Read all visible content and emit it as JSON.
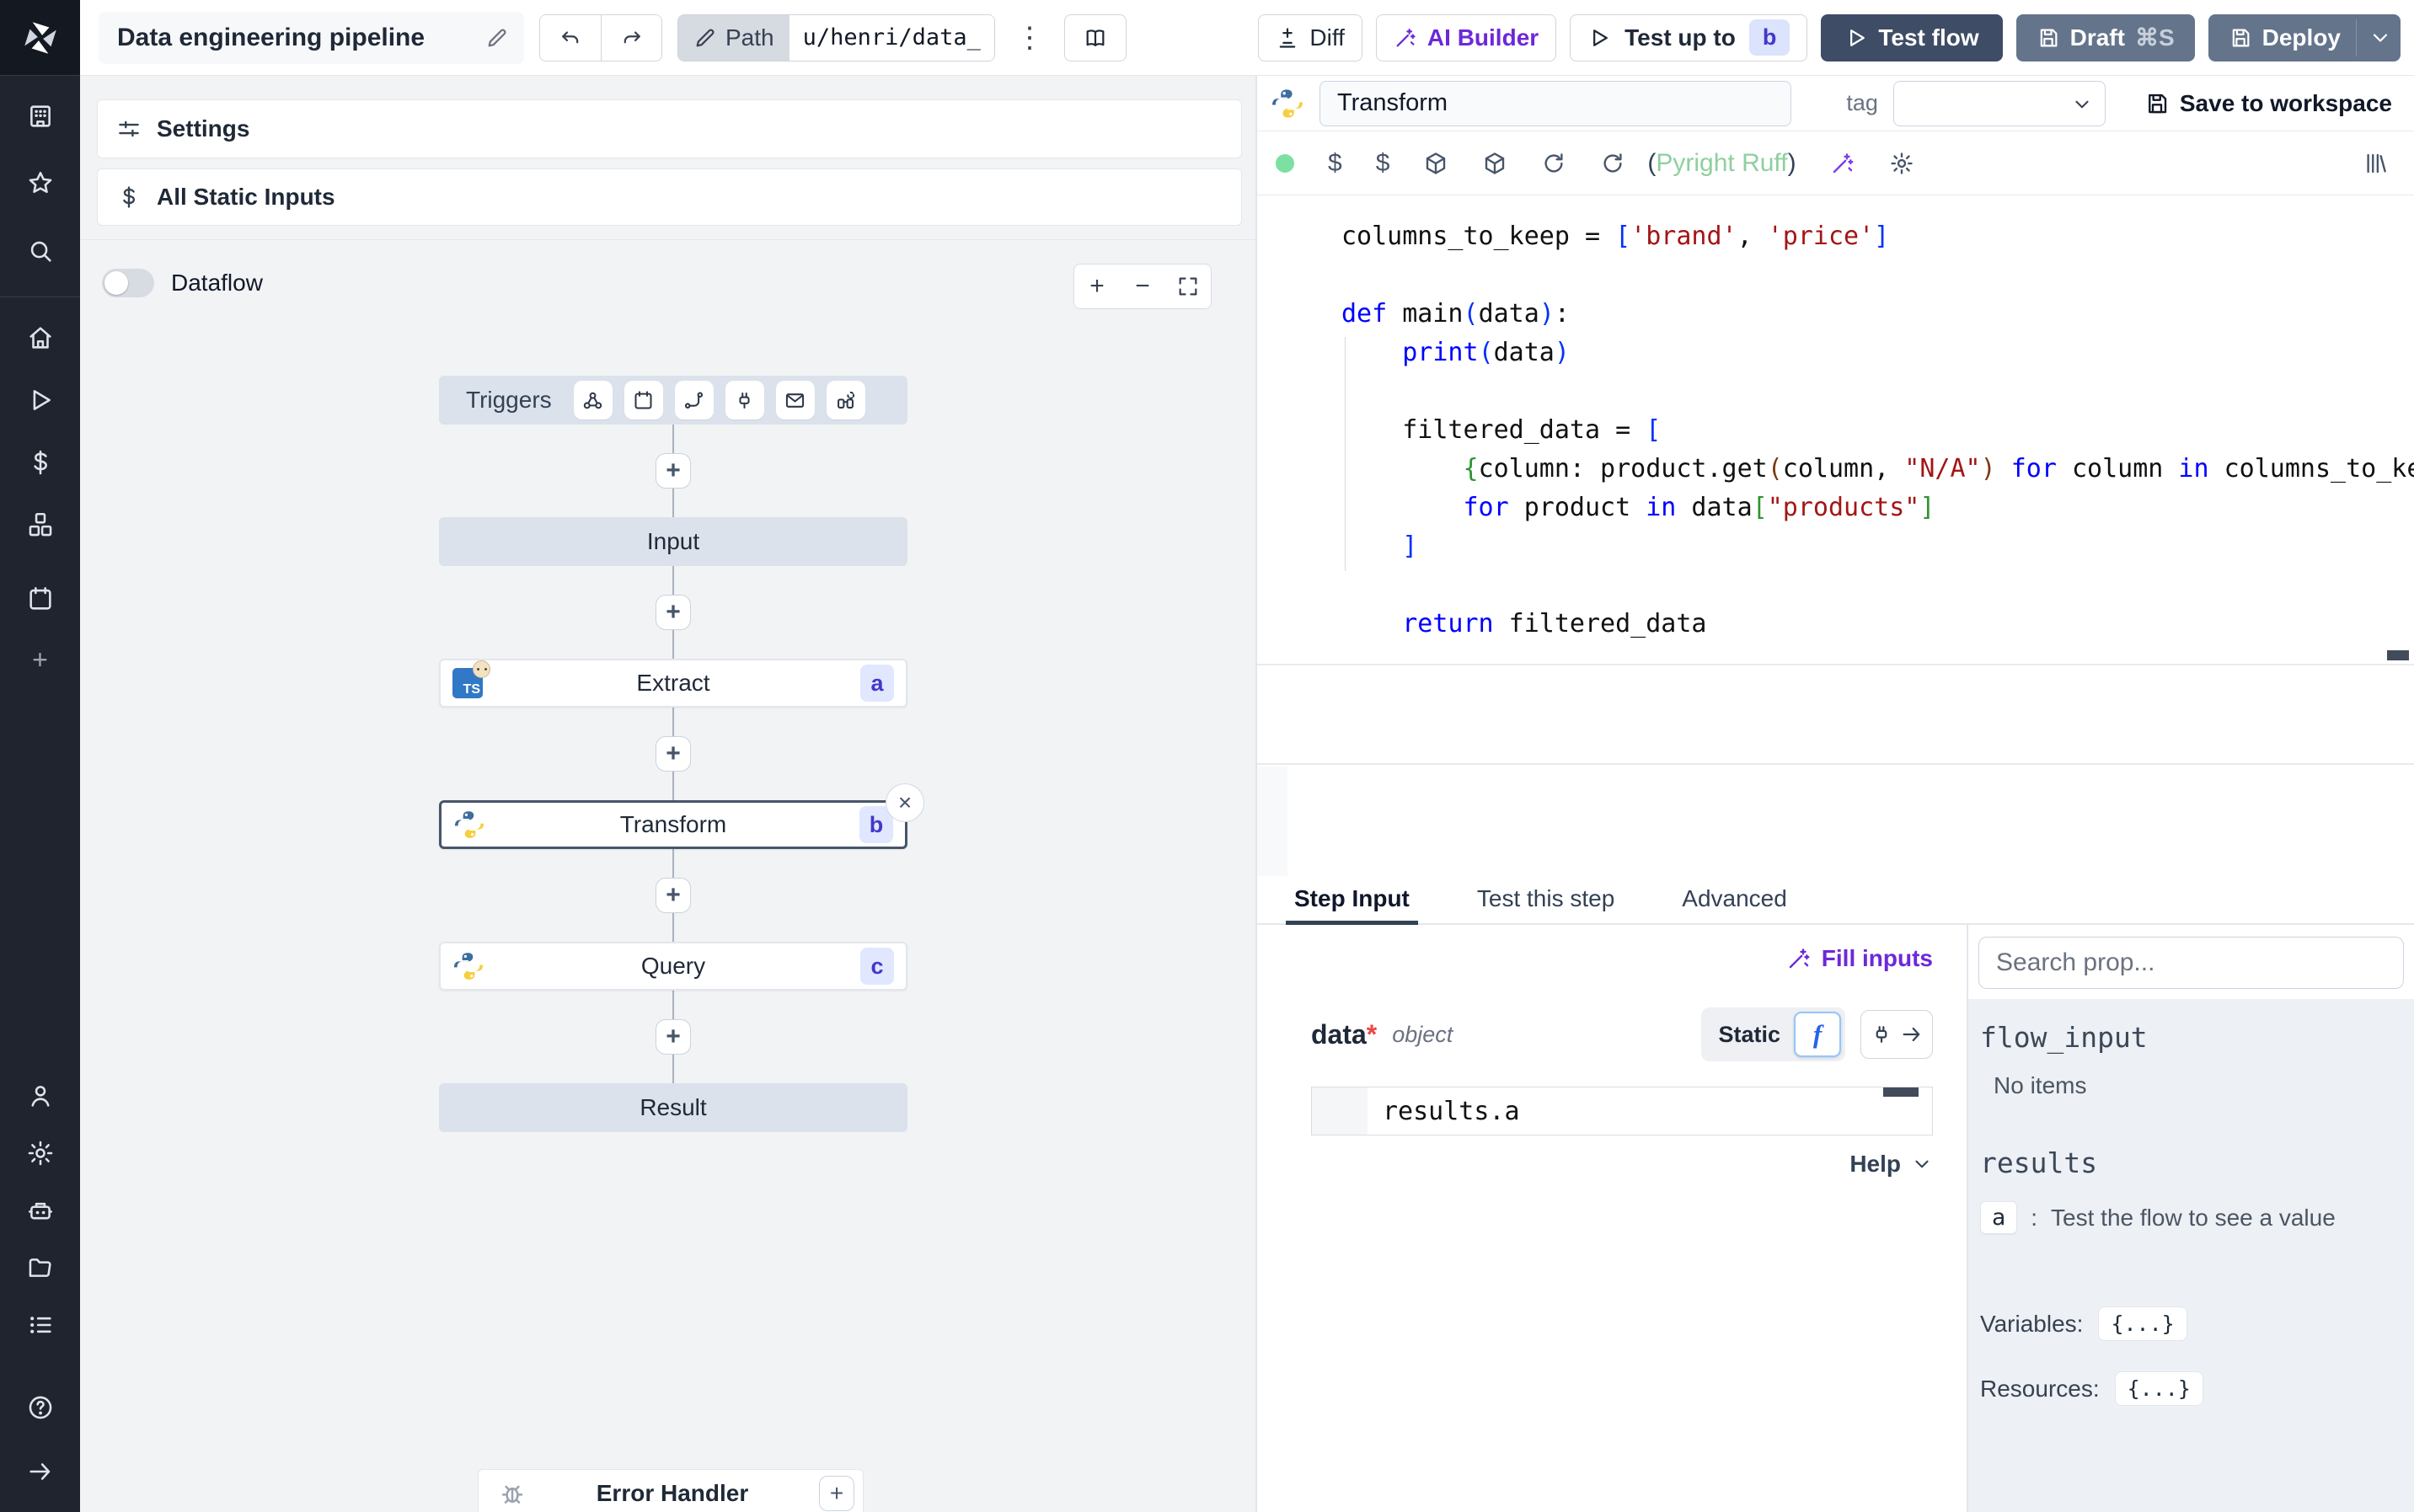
{
  "topbar": {
    "title": "Data engineering pipeline",
    "path_label": "Path",
    "path_value": "u/henri/data_",
    "diff_label": "Diff",
    "ai_builder_label": "AI Builder",
    "test_up_to_label": "Test up to",
    "test_up_to_badge": "b",
    "test_flow_label": "Test flow",
    "draft_label": "Draft",
    "draft_shortcut": "⌘S",
    "deploy_label": "Deploy"
  },
  "sidebar": {
    "icons_top": [
      "apps-icon",
      "favorites-icon",
      "search-icon"
    ],
    "icons_main": [
      "home-icon",
      "runs-icon",
      "variables-icon",
      "resources-icon",
      "schedules-icon",
      "add-icon"
    ],
    "icons_bottom": [
      "user-icon",
      "settings-icon",
      "workers-icon",
      "folders-icon",
      "logs-icon",
      "help-icon",
      "collapse-icon"
    ]
  },
  "flow_panel": {
    "settings_label": "Settings",
    "all_static_inputs_label": "All Static Inputs",
    "dataflow_label": "Dataflow",
    "graph": {
      "triggers_label": "Triggers",
      "trigger_icons": [
        "webhook-icon",
        "schedule-icon",
        "route-icon",
        "websocket-icon",
        "email-icon",
        "poll-icon"
      ],
      "input_label": "Input",
      "result_label": "Result",
      "error_handler_label": "Error Handler",
      "nodes": [
        {
          "label": "Extract",
          "badge": "a",
          "lang": "bun-typescript"
        },
        {
          "label": "Transform",
          "badge": "b",
          "lang": "python",
          "selected": true
        },
        {
          "label": "Query",
          "badge": "c",
          "lang": "python"
        }
      ]
    }
  },
  "editor": {
    "name_value": "Transform",
    "tag_label": "tag",
    "save_button": "Save to workspace",
    "lint_open": "(",
    "lint_label": "Pyright Ruff",
    "lint_close": ")"
  },
  "code": {
    "language": "python",
    "lines": [
      [
        [
          "p",
          "columns_to_keep = "
        ],
        [
          "b1",
          "["
        ],
        [
          "s",
          "'brand'"
        ],
        [
          "p",
          ", "
        ],
        [
          "s",
          "'price'"
        ],
        [
          "b1",
          "]"
        ]
      ],
      [],
      [
        [
          "k",
          "def"
        ],
        [
          "p",
          " main"
        ],
        [
          "b1",
          "("
        ],
        [
          "p",
          "data"
        ],
        [
          "b1",
          ")"
        ],
        [
          "p",
          ":"
        ]
      ],
      [
        [
          "p",
          "    "
        ],
        [
          "k",
          "print"
        ],
        [
          "b1",
          "("
        ],
        [
          "p",
          "data"
        ],
        [
          "b1",
          ")"
        ]
      ],
      [],
      [
        [
          "p",
          "    filtered_data = "
        ],
        [
          "b1",
          "["
        ]
      ],
      [
        [
          "p",
          "        "
        ],
        [
          "b2",
          "{"
        ],
        [
          "p",
          "column: product.get"
        ],
        [
          "b3",
          "("
        ],
        [
          "p",
          "column, "
        ],
        [
          "s",
          "\"N/A\""
        ],
        [
          "b3",
          ")"
        ],
        [
          "p",
          " "
        ],
        [
          "k",
          "for"
        ],
        [
          "p",
          " column "
        ],
        [
          "k",
          "in"
        ],
        [
          "p",
          " columns_to_keep"
        ],
        [
          "b2",
          "}"
        ]
      ],
      [
        [
          "p",
          "        "
        ],
        [
          "k",
          "for"
        ],
        [
          "p",
          " product "
        ],
        [
          "k",
          "in"
        ],
        [
          "p",
          " data"
        ],
        [
          "b2",
          "["
        ],
        [
          "s",
          "\"products\""
        ],
        [
          "b2",
          "]"
        ]
      ],
      [
        [
          "p",
          "    "
        ],
        [
          "b1",
          "]"
        ]
      ],
      [],
      [
        [
          "p",
          "    "
        ],
        [
          "k",
          "return"
        ],
        [
          "p",
          " filtered_data"
        ]
      ]
    ]
  },
  "tabs": [
    {
      "label": "Step Input",
      "active": true
    },
    {
      "label": "Test this step",
      "active": false
    },
    {
      "label": "Advanced",
      "active": false
    }
  ],
  "step_form": {
    "fill_inputs_label": "Fill inputs",
    "field_name": "data",
    "required_mark": "*",
    "field_type": "object",
    "static_label": "Static",
    "expr_value": "results.a",
    "help_label": "Help"
  },
  "props": {
    "search_placeholder": "Search prop...",
    "flow_input_header": "flow_input",
    "no_items": "No items",
    "results_header": "results",
    "result_key": "a",
    "result_sep": ":",
    "result_hint": "Test the flow to see a value",
    "variables_label": "Variables:",
    "variables_value": "{...}",
    "resources_label": "Resources:",
    "resources_value": "{...}"
  },
  "colors": {
    "accent_indigo": "#4338ca",
    "accent_purple": "#6d28d9",
    "test_flow_bg": "#3e4c66",
    "deploy_bg": "#64748b",
    "node_badge_bg": "#e0e7ff",
    "canvas_bg": "#f1f3f5",
    "lint_ok_green": "#8fcf9f",
    "keyword_blue": "#0000ff",
    "string_red": "#a31515"
  }
}
